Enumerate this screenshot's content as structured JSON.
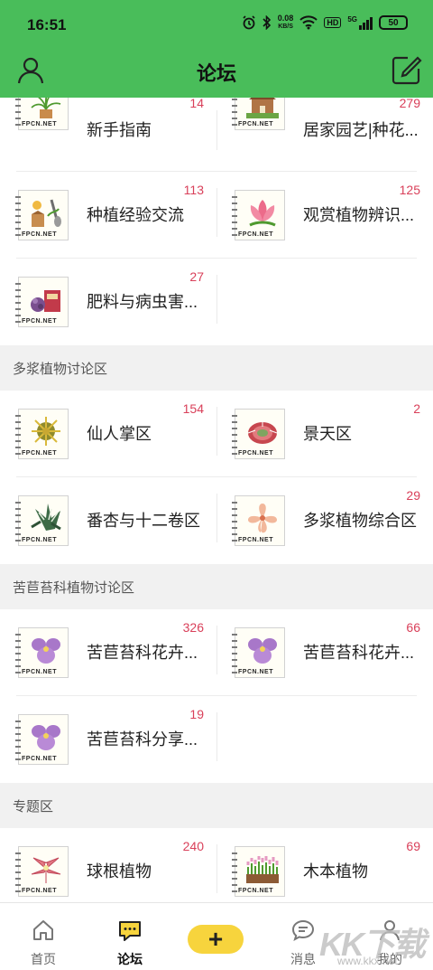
{
  "status_bar": {
    "time": "16:51",
    "net_speed": "0.08",
    "net_unit": "KB/S",
    "hd_label": "HD",
    "sig_label": "5G",
    "battery": "50"
  },
  "app_bar": {
    "title": "论坛"
  },
  "sections": [
    {
      "header": "",
      "items": [
        {
          "name": "新手指南",
          "count": "14",
          "icon": "spider-plant-icon"
        },
        {
          "name": "居家园艺|种花...",
          "count": "279",
          "icon": "house-garden-icon"
        },
        {
          "name": "种植经验交流",
          "count": "113",
          "icon": "gardening-tools-icon"
        },
        {
          "name": "观赏植物辨识...",
          "count": "125",
          "icon": "lotus-icon"
        },
        {
          "name": "肥料与病虫害...",
          "count": "27",
          "icon": "fertilizer-icon"
        }
      ]
    },
    {
      "header": "多浆植物讨论区",
      "items": [
        {
          "name": "仙人掌区",
          "count": "154",
          "icon": "cactus-icon"
        },
        {
          "name": "景天区",
          "count": "2",
          "icon": "sedum-icon"
        },
        {
          "name": "番杏与十二卷区",
          "count": "",
          "icon": "haworthia-icon"
        },
        {
          "name": "多浆植物综合区",
          "count": "29",
          "icon": "succulent-flower-icon"
        }
      ]
    },
    {
      "header": "苦苣苔科植物讨论区",
      "items": [
        {
          "name": "苦苣苔科花卉...",
          "count": "326",
          "icon": "violet-icon"
        },
        {
          "name": "苦苣苔科花卉...",
          "count": "66",
          "icon": "violet-icon"
        },
        {
          "name": "苦苣苔科分享...",
          "count": "19",
          "icon": "violet-icon"
        }
      ]
    },
    {
      "header": "专题区",
      "items": [
        {
          "name": "球根植物",
          "count": "240",
          "icon": "amaryllis-icon"
        },
        {
          "name": "木本植物",
          "count": "69",
          "icon": "flower-bed-icon"
        }
      ]
    }
  ],
  "thumb_caption": "FPCN.NET",
  "bottom_nav": [
    {
      "label": "首页",
      "icon": "home-icon"
    },
    {
      "label": "论坛",
      "icon": "forum-chat-icon"
    },
    {
      "label": "",
      "icon": "plus-icon",
      "text": "+"
    },
    {
      "label": "消息",
      "icon": "message-icon"
    },
    {
      "label": "我的",
      "icon": "profile-icon"
    }
  ],
  "watermark": {
    "big": "KK下载",
    "small": "www.kkx.net"
  },
  "colors": {
    "primary_green": "#49bd5a",
    "count_red": "#d9405a",
    "post_yellow": "#f7d43d"
  }
}
